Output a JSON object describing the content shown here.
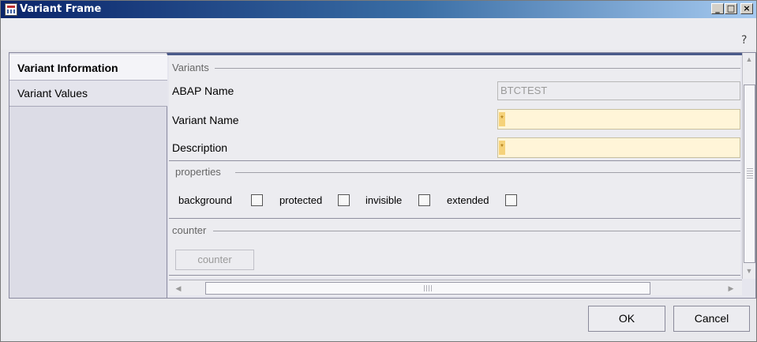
{
  "window": {
    "title": "Variant Frame",
    "controls": {
      "minimize": "_",
      "maximize": "□",
      "close": "×"
    },
    "help_icon": "?"
  },
  "sidebar": {
    "tabs": [
      {
        "label": "Variant Information",
        "active": true
      },
      {
        "label": "Variant Values",
        "active": false
      }
    ]
  },
  "variants_group": {
    "title": "Variants",
    "fields": {
      "abap_name": {
        "label": "ABAP Name",
        "value": "BTCTEST"
      },
      "variant_name": {
        "label": "Variant Name",
        "value": "",
        "required_mark": "*"
      },
      "description": {
        "label": "Description",
        "value": "",
        "required_mark": "*"
      }
    }
  },
  "properties_group": {
    "title": "properties",
    "checkboxes": [
      {
        "label": "background",
        "checked": false
      },
      {
        "label": "protected",
        "checked": false
      },
      {
        "label": "invisible",
        "checked": false
      },
      {
        "label": "extended",
        "checked": false
      }
    ]
  },
  "counter_group": {
    "title": "counter",
    "button_label": "counter"
  },
  "footer": {
    "ok_label": "OK",
    "cancel_label": "Cancel"
  },
  "colors": {
    "titlebar_start": "#0a246a",
    "required_field_bg": "#fff5d8",
    "required_mark_bg": "#f5d27a"
  }
}
